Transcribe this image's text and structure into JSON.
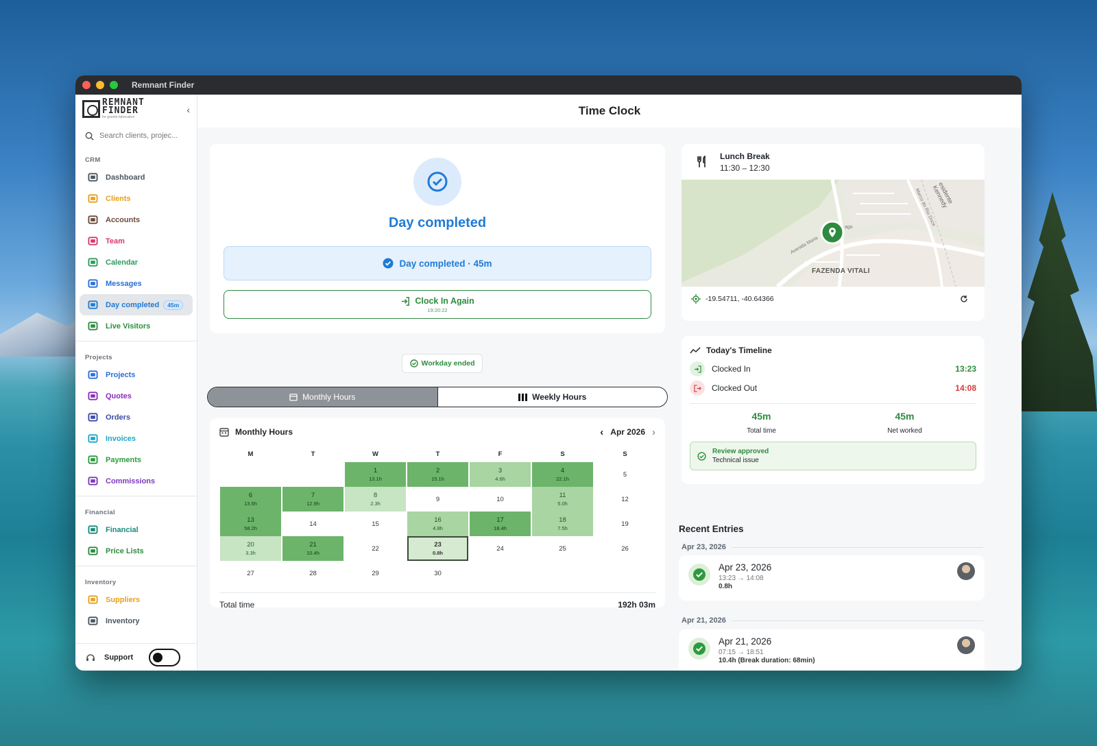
{
  "window": {
    "title": "Remnant Finder"
  },
  "brand": {
    "line1": "REMNANT",
    "line2": "FINDER",
    "tagline": "for granite fabricators"
  },
  "search": {
    "placeholder": "Search clients, projec..."
  },
  "sidebar": {
    "crm_label": "CRM",
    "crm": [
      {
        "label": "Dashboard",
        "icon": "dashboard-icon",
        "color": "#4a5560"
      },
      {
        "label": "Clients",
        "icon": "clients-icon",
        "color": "#e8a019"
      },
      {
        "label": "Accounts",
        "icon": "accounts-icon",
        "color": "#6b4a3a"
      },
      {
        "label": "Team",
        "icon": "team-icon",
        "color": "#d63a6a"
      },
      {
        "label": "Calendar",
        "icon": "calendar-icon",
        "color": "#2e9a5e"
      },
      {
        "label": "Messages",
        "icon": "messages-icon",
        "color": "#2a6fd6"
      },
      {
        "label": "Day completed",
        "badge": "45m",
        "icon": "check-circle-icon",
        "color": "#1f7bd6"
      },
      {
        "label": "Live Visitors",
        "icon": "live-visitors-icon",
        "color": "#2e8b3e"
      }
    ],
    "projects_label": "Projects",
    "projects": [
      {
        "label": "Projects",
        "icon": "folder-icon",
        "color": "#2a6fd6"
      },
      {
        "label": "Quotes",
        "icon": "quotes-icon",
        "color": "#8a2fb8"
      },
      {
        "label": "Orders",
        "icon": "orders-icon",
        "color": "#3a4aa8"
      },
      {
        "label": "Invoices",
        "icon": "invoices-icon",
        "color": "#1aa6c8"
      },
      {
        "label": "Payments",
        "icon": "payments-icon",
        "color": "#2e9a3e"
      },
      {
        "label": "Commissions",
        "icon": "commissions-icon",
        "color": "#7a3ab8"
      }
    ],
    "financial_label": "Financial",
    "financial": [
      {
        "label": "Financial",
        "icon": "financial-icon",
        "color": "#1a8a7a"
      },
      {
        "label": "Price Lists",
        "icon": "price-lists-icon",
        "color": "#2e8b3e"
      }
    ],
    "inventory_label": "Inventory",
    "inventory": [
      {
        "label": "Suppliers",
        "icon": "truck-icon",
        "color": "#e8a019"
      },
      {
        "label": "Inventory",
        "icon": "inventory-icon",
        "color": "#4a5560"
      }
    ],
    "support": "Support"
  },
  "page": {
    "title": "Time Clock"
  },
  "status": {
    "title": "Day completed",
    "bar": "Day completed · 45m",
    "clock_again": "Clock In Again",
    "clock_again_time": "19:20:22",
    "workday": "Workday ended"
  },
  "tabs": {
    "monthly": "Monthly Hours",
    "weekly": "Weekly Hours"
  },
  "calendar": {
    "title": "Monthly Hours",
    "month": "Apr 2026",
    "weekdays": [
      "M",
      "T",
      "W",
      "T",
      "F",
      "S",
      "S"
    ],
    "days": [
      {
        "d": "",
        "h": "",
        "l": 0
      },
      {
        "d": "",
        "h": "",
        "l": 0
      },
      {
        "d": "1",
        "h": "13.1h",
        "l": 3
      },
      {
        "d": "2",
        "h": "15.1h",
        "l": 3
      },
      {
        "d": "3",
        "h": "4.6h",
        "l": 2
      },
      {
        "d": "4",
        "h": "22.1h",
        "l": 3
      },
      {
        "d": "5",
        "h": "",
        "l": 0
      },
      {
        "d": "6",
        "h": "13.5h",
        "l": 3
      },
      {
        "d": "7",
        "h": "12.9h",
        "l": 3
      },
      {
        "d": "8",
        "h": "2.3h",
        "l": 1
      },
      {
        "d": "9",
        "h": "",
        "l": 0
      },
      {
        "d": "10",
        "h": "",
        "l": 0
      },
      {
        "d": "11",
        "h": "5.0h",
        "l": 2
      },
      {
        "d": "12",
        "h": "",
        "l": 0
      },
      {
        "d": "13",
        "h": "58.2h",
        "l": 3
      },
      {
        "d": "14",
        "h": "",
        "l": 0
      },
      {
        "d": "15",
        "h": "",
        "l": 0
      },
      {
        "d": "16",
        "h": "4.8h",
        "l": 2
      },
      {
        "d": "17",
        "h": "18.4h",
        "l": 3
      },
      {
        "d": "18",
        "h": "7.5h",
        "l": 2
      },
      {
        "d": "19",
        "h": "",
        "l": 0
      },
      {
        "d": "20",
        "h": "3.3h",
        "l": 1
      },
      {
        "d": "21",
        "h": "10.4h",
        "l": 3
      },
      {
        "d": "22",
        "h": "",
        "l": 0
      },
      {
        "d": "23",
        "h": "0.8h",
        "l": 9
      },
      {
        "d": "24",
        "h": "",
        "l": 0
      },
      {
        "d": "25",
        "h": "",
        "l": 0
      },
      {
        "d": "26",
        "h": "",
        "l": 0
      },
      {
        "d": "27",
        "h": "",
        "l": 0
      },
      {
        "d": "28",
        "h": "",
        "l": 0
      },
      {
        "d": "29",
        "h": "",
        "l": 0
      },
      {
        "d": "30",
        "h": "",
        "l": 0
      },
      {
        "d": "",
        "h": "",
        "l": 0
      },
      {
        "d": "",
        "h": "",
        "l": 0
      },
      {
        "d": "",
        "h": "",
        "l": 0
      }
    ],
    "total_label": "Total time",
    "total_value": "192h 03m"
  },
  "lunch": {
    "title": "Lunch Break",
    "time": "11:30 – 12:30"
  },
  "map": {
    "place": "FAZENDA VITALI",
    "road1": "Avenida Maria",
    "road2": "Marco do Rio Doce",
    "road3": "esidente Kennedy",
    "road4": "ago",
    "coords": "-19.54711, -40.64366"
  },
  "timeline": {
    "title": "Today's Timeline",
    "in_label": "Clocked In",
    "in_time": "13:23",
    "out_label": "Clocked Out",
    "out_time": "14:08",
    "total_value": "45m",
    "total_label": "Total time",
    "net_value": "45m",
    "net_label": "Net worked",
    "review_status": "Review approved",
    "review_note": "Technical issue"
  },
  "recent": {
    "title": "Recent Entries",
    "groups": [
      {
        "header": "Apr 23, 2026",
        "date": "Apr 23, 2026",
        "time": "13:23 → 14:08",
        "hours": "0.8h"
      },
      {
        "header": "Apr 21, 2026",
        "date": "Apr 21, 2026",
        "time": "07:15 → 18:51",
        "hours": "10.4h (Break duration: 68min)"
      }
    ]
  }
}
